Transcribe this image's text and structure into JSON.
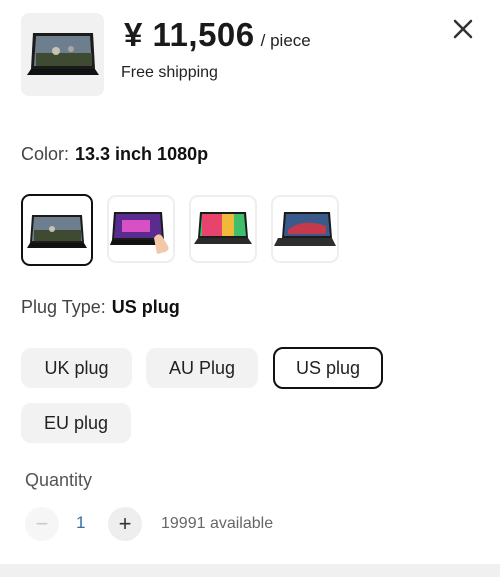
{
  "header": {
    "price": "¥ 11,506",
    "unit": "/ piece",
    "shipping": "Free shipping"
  },
  "color": {
    "label": "Color:",
    "selected": "13.3 inch 1080p",
    "options": [
      "13.3 inch 1080p",
      "touch screen",
      "colorful screen",
      "stand cover"
    ]
  },
  "plug": {
    "label": "Plug Type:",
    "selected": "US plug",
    "options": [
      "UK plug",
      "AU Plug",
      "US plug",
      "EU plug"
    ]
  },
  "quantity": {
    "label": "Quantity",
    "value": "1",
    "available": "19991 available",
    "minus": "−",
    "plus": "+"
  },
  "colors": {
    "selected_border": "#111111",
    "chip_bg": "#f2f2f2",
    "qty_value": "#3a6ea5"
  }
}
